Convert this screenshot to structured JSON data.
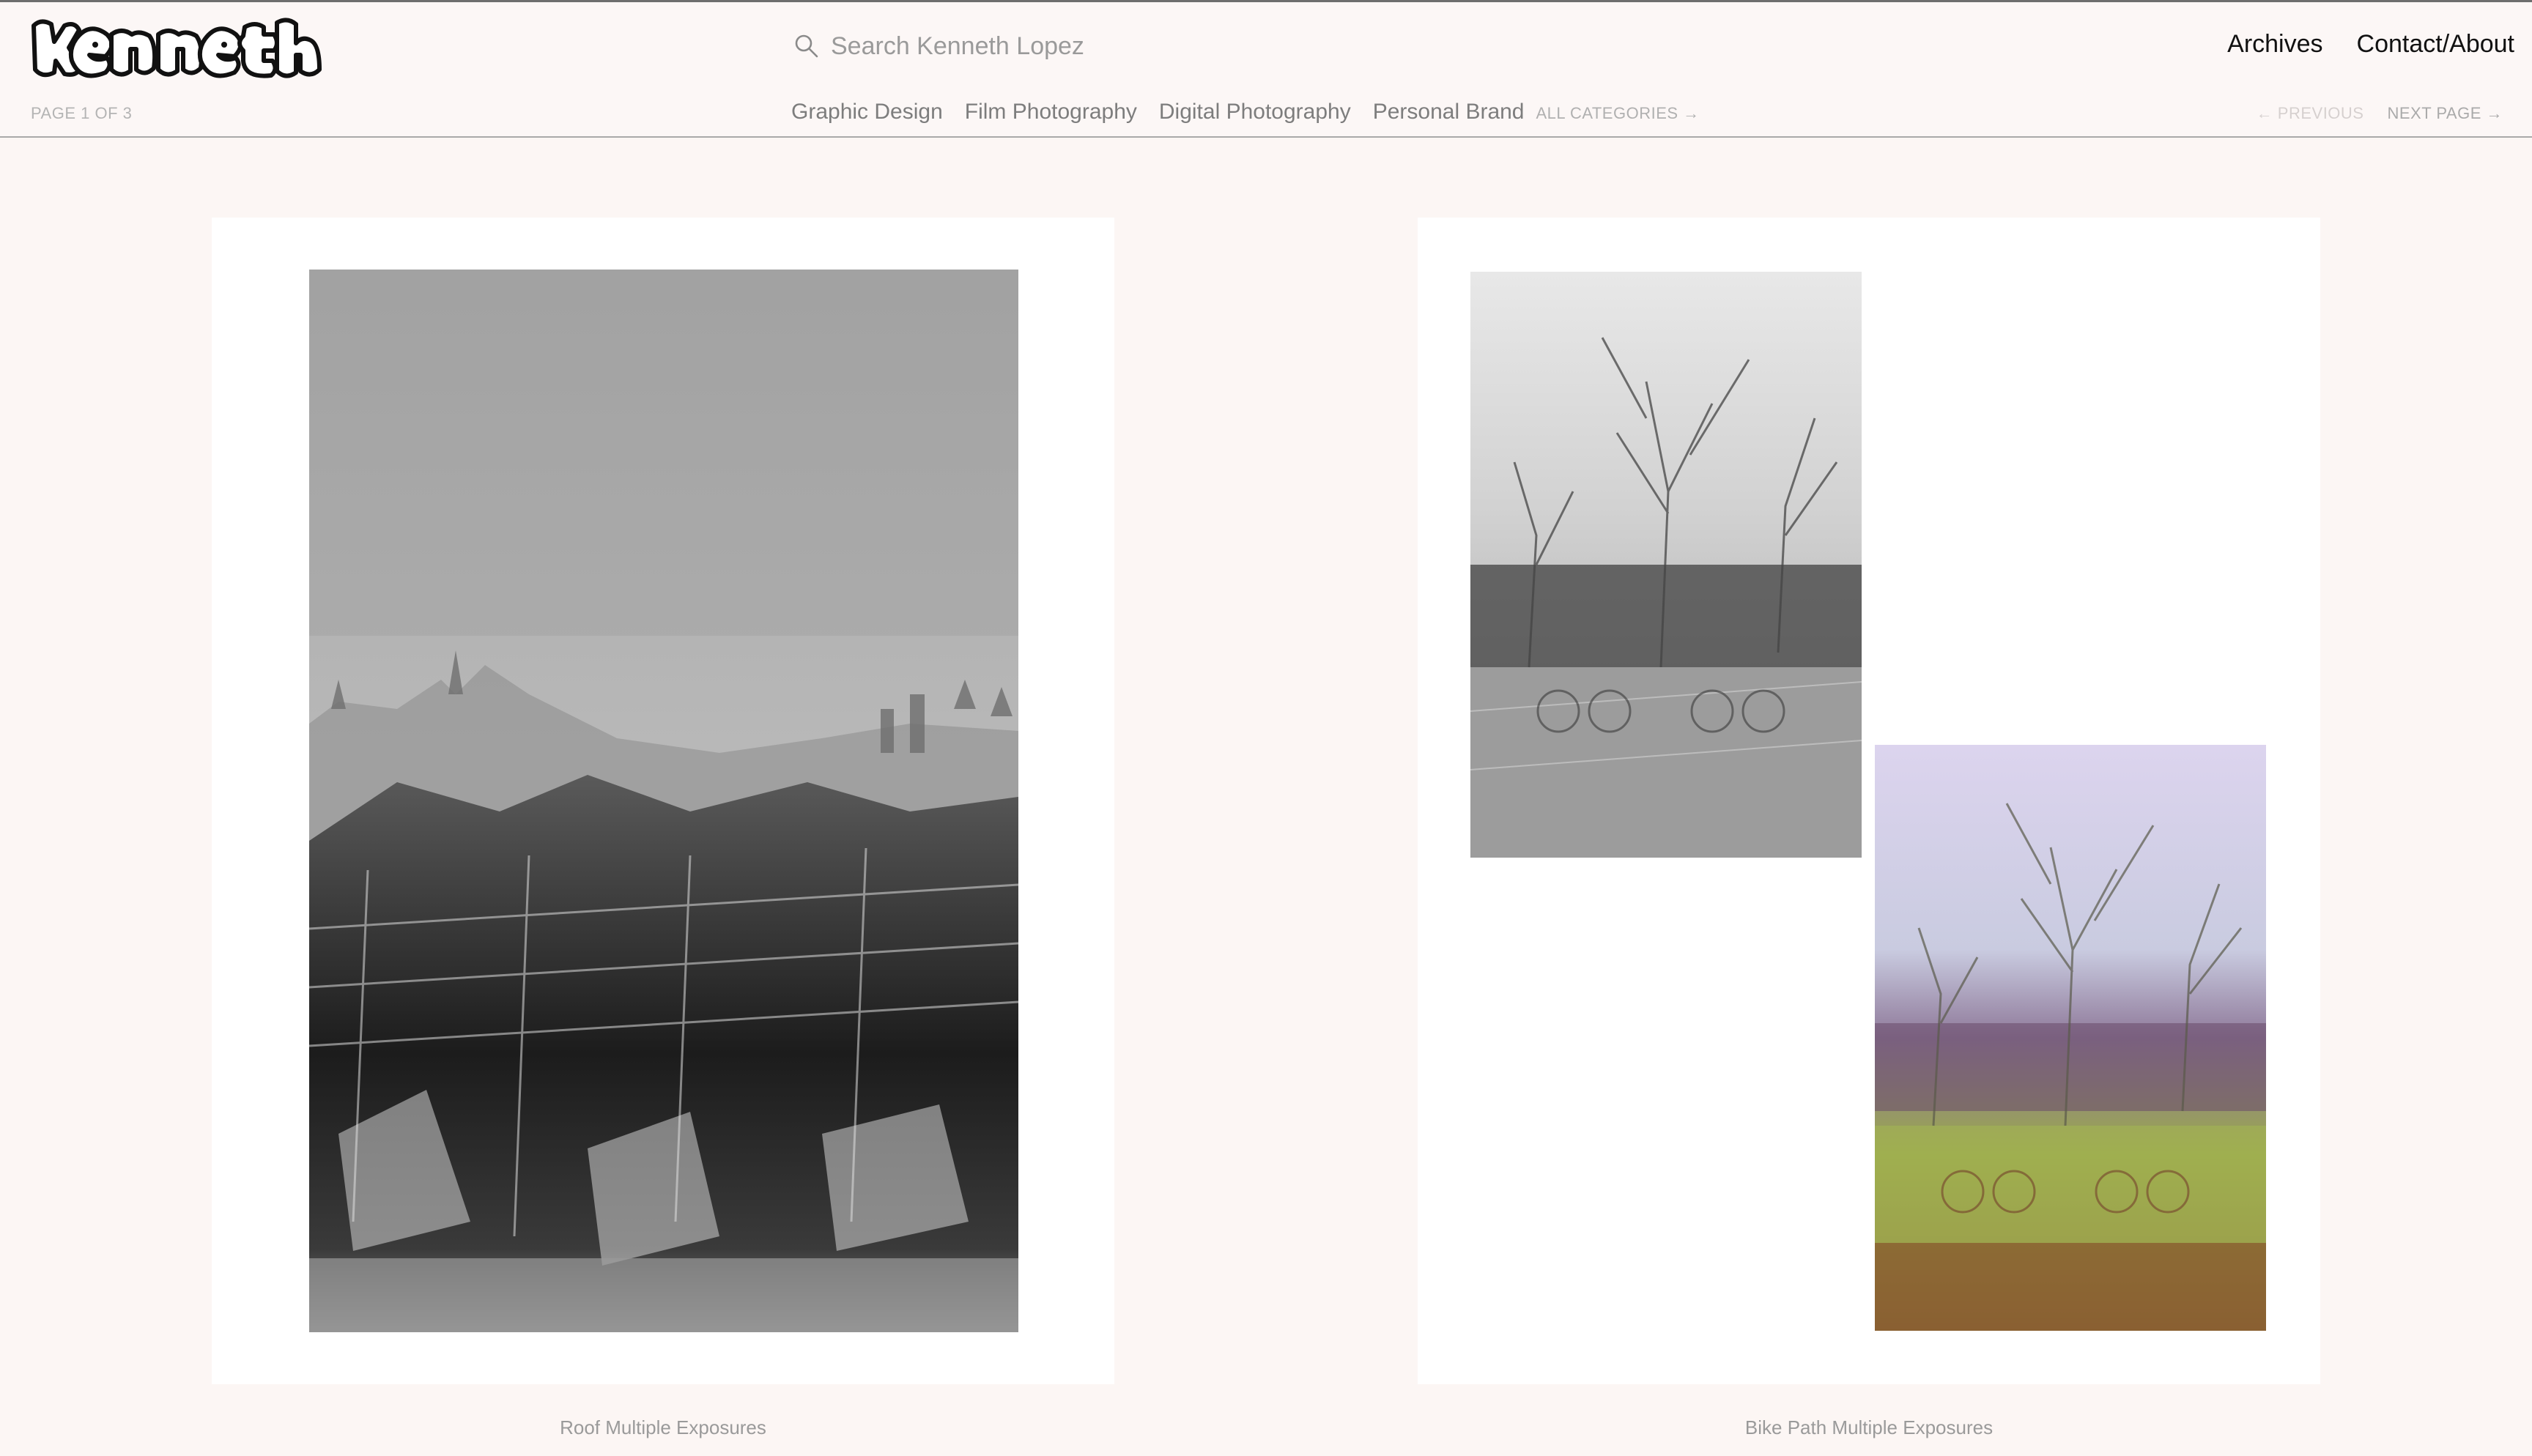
{
  "brand": {
    "logo_text": "Kenneth"
  },
  "search": {
    "placeholder": "Search Kenneth Lopez",
    "value": ""
  },
  "nav": {
    "archives": "Archives",
    "contact": "Contact/About"
  },
  "pagination": {
    "page_info": "PAGE 1 OF 3",
    "previous": "← PREVIOUS",
    "next": "NEXT PAGE →"
  },
  "categories": {
    "items": [
      "Graphic Design",
      "Film Photography",
      "Digital Photography",
      "Personal Brand"
    ],
    "all": "ALL CATEGORIES →"
  },
  "posts": [
    {
      "caption": "Roof Multiple Exposures"
    },
    {
      "caption": "Bike Path Multiple Exposures"
    }
  ],
  "colors": {
    "background": "#fcf6f4",
    "card": "#ffffff",
    "muted_text": "#9a9a9a",
    "nav_text": "#111111"
  },
  "icons": {
    "search": "search-icon"
  }
}
